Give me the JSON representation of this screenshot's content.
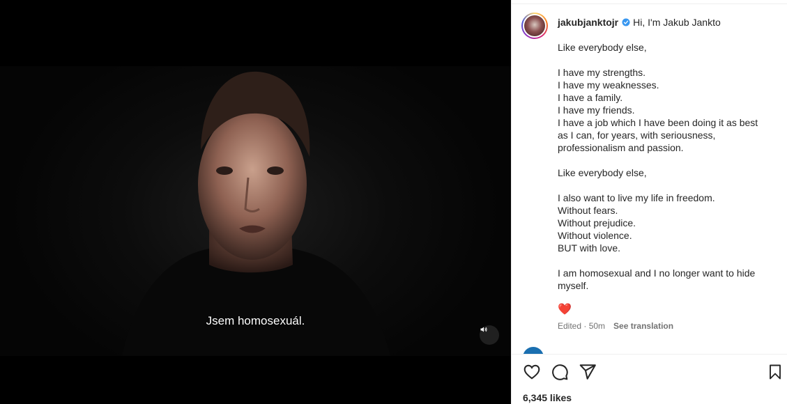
{
  "video": {
    "subtitle": "Jsem homosexuál.",
    "mute_icon": "speaker-icon"
  },
  "post": {
    "username": "jakubjanktojr",
    "verified": true,
    "caption_head": "Hi, I'm Jakub Jankto",
    "caption_lines": [
      "Like everybody else,",
      "",
      "I have my strengths.",
      "I have my weaknesses.",
      "I have a family.",
      "I have my friends.",
      "I have a job which I have been doing it as best",
      "as I can, for years, with seriousness,",
      "professionalism and passion.",
      "",
      "Like everybody else,",
      "",
      "I also want to live my life in freedom.",
      "Without fears.",
      "Without prejudice.",
      "Without violence.",
      "BUT with love.",
      "",
      "I am homosexual and I no longer want to hide",
      "myself."
    ],
    "emoji": "❤️",
    "edited": "Edited · 50m",
    "see_translation": "See translation",
    "likes": "6,345 likes"
  },
  "colors": {
    "verified_badge": "#3897f0",
    "meta_text": "#737373",
    "video_bg": "#000000"
  },
  "icons": {
    "like": "heart-icon",
    "comment": "comment-icon",
    "share": "share-icon",
    "save": "bookmark-icon"
  }
}
